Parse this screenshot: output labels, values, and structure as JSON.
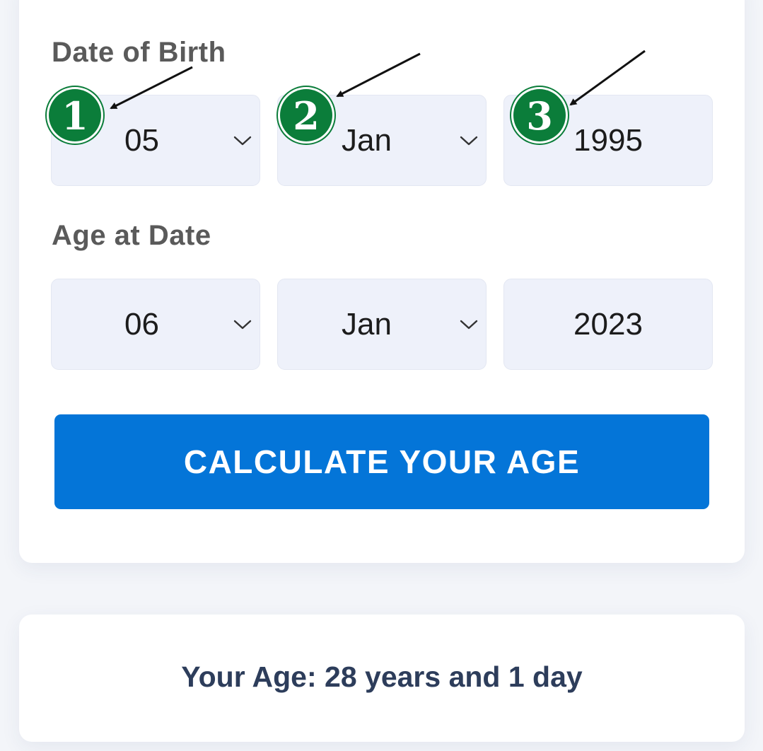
{
  "date_of_birth": {
    "label": "Date of Birth",
    "day": "05",
    "month": "Jan",
    "year": "1995"
  },
  "age_at_date": {
    "label": "Age at Date",
    "day": "06",
    "month": "Jan",
    "year": "2023"
  },
  "calculate_button": {
    "label": "CALCULATE YOUR AGE"
  },
  "result": {
    "text": "Your Age: 28 years and 1 day"
  },
  "annotations": {
    "badges": [
      "1",
      "2",
      "3"
    ],
    "badge_color": "#0b7d3a",
    "arrow_color": "#111111"
  },
  "colors": {
    "button": "#0475d8",
    "field_background": "#eef1fa",
    "result_text": "#2d3d5b"
  },
  "icons": [
    "chevron-down-icon",
    "numbered-badge",
    "annotation-arrow"
  ]
}
